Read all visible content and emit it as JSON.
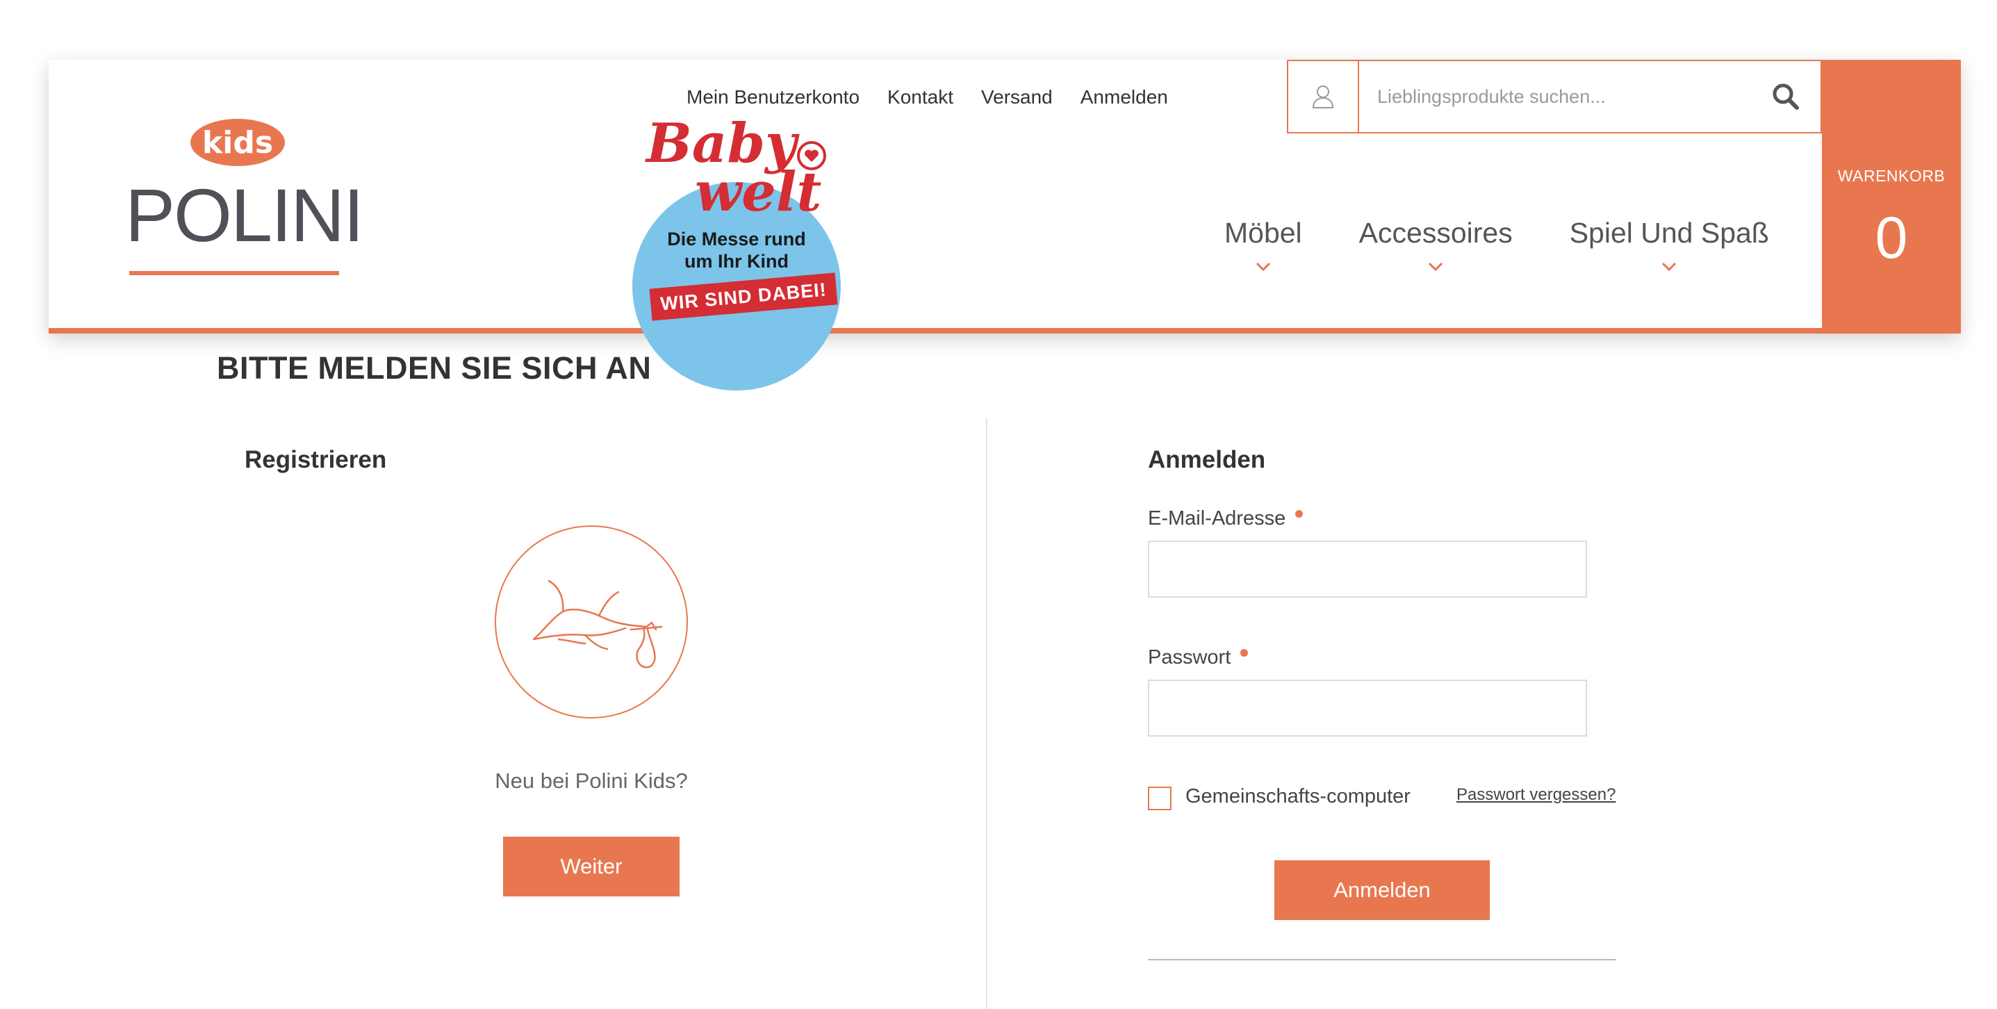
{
  "brand": {
    "logo_top": "kids",
    "logo_main": "POLINI",
    "accent_color": "#e8774f"
  },
  "top_nav": [
    {
      "label": "Mein Benutzerkonto"
    },
    {
      "label": "Kontakt"
    },
    {
      "label": "Versand"
    },
    {
      "label": "Anmelden"
    }
  ],
  "babywelt": {
    "title_line1": "Baby",
    "title_line2": "welt",
    "subtitle_line1": "Die Messe rund",
    "subtitle_line2": "um Ihr Kind",
    "banner": "WIR SIND DABEI!"
  },
  "search": {
    "placeholder": "Lieblingsprodukte suchen...",
    "value": "",
    "user_icon": "user-icon",
    "search_icon": "search-icon"
  },
  "main_nav": [
    {
      "label": "Möbel"
    },
    {
      "label": "Accessoires"
    },
    {
      "label": "Spiel Und Spaß"
    }
  ],
  "cart": {
    "label": "WARENKORB",
    "count": "0"
  },
  "page": {
    "title": "BITTE MELDEN SIE SICH AN"
  },
  "register": {
    "heading": "Registrieren",
    "icon": "stork-icon",
    "text": "Neu bei Polini Kids?",
    "button": "Weiter"
  },
  "login": {
    "heading": "Anmelden",
    "email_label": "E-Mail-Adresse",
    "email_value": "",
    "password_label": "Passwort",
    "password_value": "",
    "shared_computer_label": "Gemeinschafts-computer",
    "shared_computer_checked": false,
    "forgot_label": "Passwort vergessen?",
    "button": "Anmelden"
  }
}
